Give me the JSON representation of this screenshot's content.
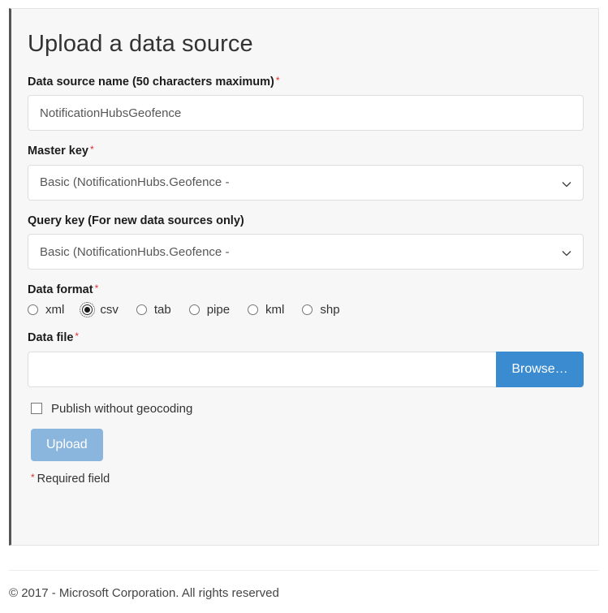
{
  "page": {
    "title": "Upload a data source"
  },
  "form": {
    "data_source_name": {
      "label": "Data source name (50 characters maximum)",
      "required_marker": "*",
      "value": "NotificationHubsGeofence",
      "placeholder": ""
    },
    "master_key": {
      "label": "Master key",
      "required_marker": "*",
      "selected": "Basic (NotificationHubs.Geofence - "
    },
    "query_key": {
      "label": "Query key (For new data sources only)",
      "selected": "Basic (NotificationHubs.Geofence - "
    },
    "data_format": {
      "label": "Data format",
      "required_marker": "*",
      "options": [
        {
          "label": "xml",
          "checked": false
        },
        {
          "label": "csv",
          "checked": true
        },
        {
          "label": "tab",
          "checked": false
        },
        {
          "label": "pipe",
          "checked": false
        },
        {
          "label": "kml",
          "checked": false
        },
        {
          "label": "shp",
          "checked": false
        }
      ]
    },
    "data_file": {
      "label": "Data file",
      "required_marker": "*",
      "value": "",
      "browse_label": "Browse…"
    },
    "publish_without_geocoding": {
      "label": "Publish without geocoding",
      "checked": false
    },
    "submit": {
      "label": "Upload"
    },
    "required_note": {
      "marker": "*",
      "text": "Required field"
    }
  },
  "footer": {
    "copyright": "© 2017 - Microsoft Corporation. All rights reserved"
  },
  "colors": {
    "accent_blue": "#3b8bd0",
    "disabled_blue": "#8ab6dd",
    "required_red": "#e03131",
    "panel_bg": "#f7f7f7",
    "panel_accent_border": "#555555"
  }
}
